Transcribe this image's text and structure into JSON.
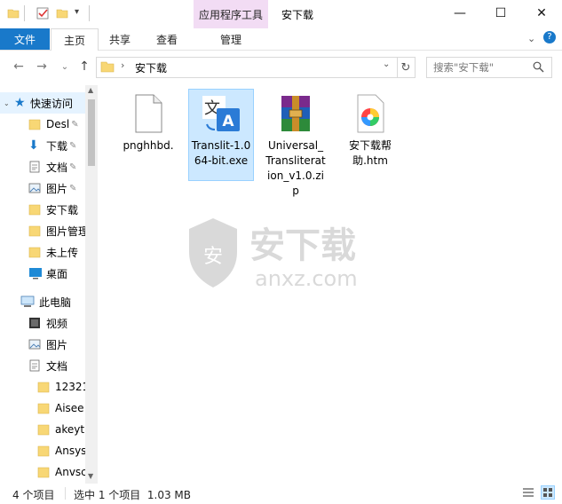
{
  "titlebar": {
    "ribbon_context_group": "应用程序工具",
    "window_title": "安下载",
    "minimize": "—",
    "maximize": "☐",
    "close": "✕"
  },
  "ribbon": {
    "file": "文件",
    "home": "主页",
    "share": "共享",
    "view": "查看",
    "manage": "管理"
  },
  "address": {
    "path": "安下载",
    "search_placeholder": "搜索\"安下载\""
  },
  "sidebar": {
    "items": [
      {
        "label": "快速访问",
        "icon": "star-icon"
      },
      {
        "label": "Desl",
        "icon": "folder-icon",
        "pinned": true
      },
      {
        "label": "下载",
        "icon": "download-arrow-icon",
        "pinned": true
      },
      {
        "label": "文档",
        "icon": "document-icon",
        "pinned": true
      },
      {
        "label": "图片",
        "icon": "picture-icon",
        "pinned": true
      },
      {
        "label": "安下载",
        "icon": "folder-icon"
      },
      {
        "label": "图片管理",
        "icon": "folder-icon"
      },
      {
        "label": "未上传",
        "icon": "folder-icon"
      },
      {
        "label": "桌面",
        "icon": "desktop-icon"
      },
      {
        "label": "此电脑",
        "icon": "computer-icon"
      },
      {
        "label": "视频",
        "icon": "video-icon"
      },
      {
        "label": "图片",
        "icon": "picture-icon"
      },
      {
        "label": "文档",
        "icon": "document-icon"
      },
      {
        "label": "12321",
        "icon": "folder-icon"
      },
      {
        "label": "Aisee",
        "icon": "folder-icon"
      },
      {
        "label": "akeyt",
        "icon": "folder-icon"
      },
      {
        "label": "Ansys",
        "icon": "folder-icon"
      },
      {
        "label": "Anvsc",
        "icon": "folder-icon"
      }
    ]
  },
  "files": [
    {
      "name": "pnghhbd.",
      "icon": "blank-file-icon"
    },
    {
      "name": "Translit-1.064-bit.exe",
      "icon": "translate-app-icon",
      "selected": true
    },
    {
      "name": "Universal_Transliteration_v1.0.zip",
      "icon": "winrar-archive-icon"
    },
    {
      "name": "安下载帮助.htm",
      "icon": "colorful-browser-icon"
    }
  ],
  "watermark": {
    "text": "安下载",
    "domain": "anxz.com"
  },
  "status": {
    "count": "4 个项目",
    "selection": "选中 1 个项目  1.03 MB"
  },
  "colors": {
    "accent": "#1979ca",
    "selected_bg": "#cce8ff",
    "app_tools_bg": "#f2dcf4",
    "folder": "#f8d775"
  }
}
